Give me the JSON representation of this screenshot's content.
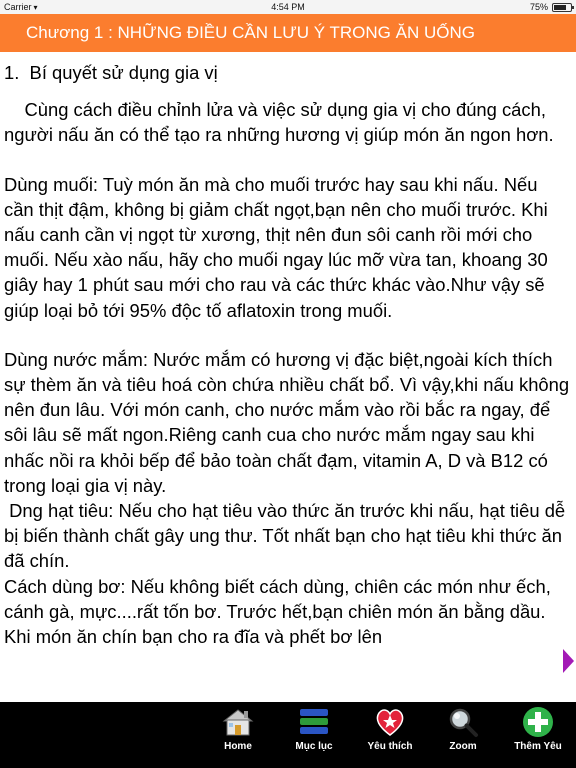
{
  "status_bar": {
    "carrier": "Carrier",
    "time": "4:54 PM",
    "battery_percent": "75%",
    "battery_level": 0.75
  },
  "title": "Chương 1 : NHỮNG ĐIỀU CẦN LƯU Ý TRONG ĂN UỐNG",
  "content": {
    "heading": "1.  Bí quyết sử dụng gia vị",
    "paragraphs": [
      "    Cùng cách điều chỉnh lửa và việc sử dụng gia vị cho đúng cách, người nấu ăn có thể tạo ra những hương vị giúp món ăn ngon hơn.",
      "Dùng muối: Tuỳ món ăn mà cho muối trước hay sau khi nấu. Nếu cần thịt đậm, không bị giảm chất ngọt,bạn nên cho muối trước. Khi nấu canh cần vị ngọt từ xương, thịt nên đun sôi canh rồi mới cho muối. Nếu xào nấu, hãy cho muối ngay lúc mỡ vừa tan, khoang 30 giây hay 1 phút sau mới cho rau và các thức khác vào.Như vậy sẽ giúp loại bỏ tới 95% độc tố aflatoxin trong muối.",
      "Dùng nước mắm: Nước mắm có hương vị đặc biệt,ngoài kích thích sự thèm ăn và tiêu hoá còn chứa nhiều chất bổ. Vì vậy,khi nấu không nên đun lâu. Với món canh, cho nước mắm vào rồi bắc ra ngay, để sôi lâu sẽ mất ngon.Riêng canh cua cho nước mắm ngay sau khi nhấc nồi ra khỏi bếp để bảo toàn chất đạm, vitamin A, D và B12 có trong loại gia vị này.\n Dng hạt tiêu: Nếu cho hạt tiêu vào thức ăn trước khi nấu, hạt tiêu dễ bị biến thành chất gây ung thư. Tốt nhất bạn cho hạt tiêu khi thức ăn đã chín.\nCách dùng bơ: Nếu không biết cách dùng, chiên các món như ếch, cánh gà, mực....rất tốn bơ. Trước hết,bạn chiên món ăn bằng dầu. Khi món ăn chín bạn cho ra đĩa và phết bơ lên"
    ]
  },
  "tabs": [
    {
      "label": "Home",
      "icon": "home-icon"
    },
    {
      "label": "Mục lục",
      "icon": "list-icon"
    },
    {
      "label": "Yêu thích",
      "icon": "heart-star-icon"
    },
    {
      "label": "Zoom",
      "icon": "magnifier-icon"
    },
    {
      "label": "Thêm Yêu",
      "icon": "plus-icon"
    }
  ],
  "colors": {
    "title_bar": "#fb7d2e",
    "tab_bar": "#000000",
    "next_arrow": "#a31ab6"
  }
}
